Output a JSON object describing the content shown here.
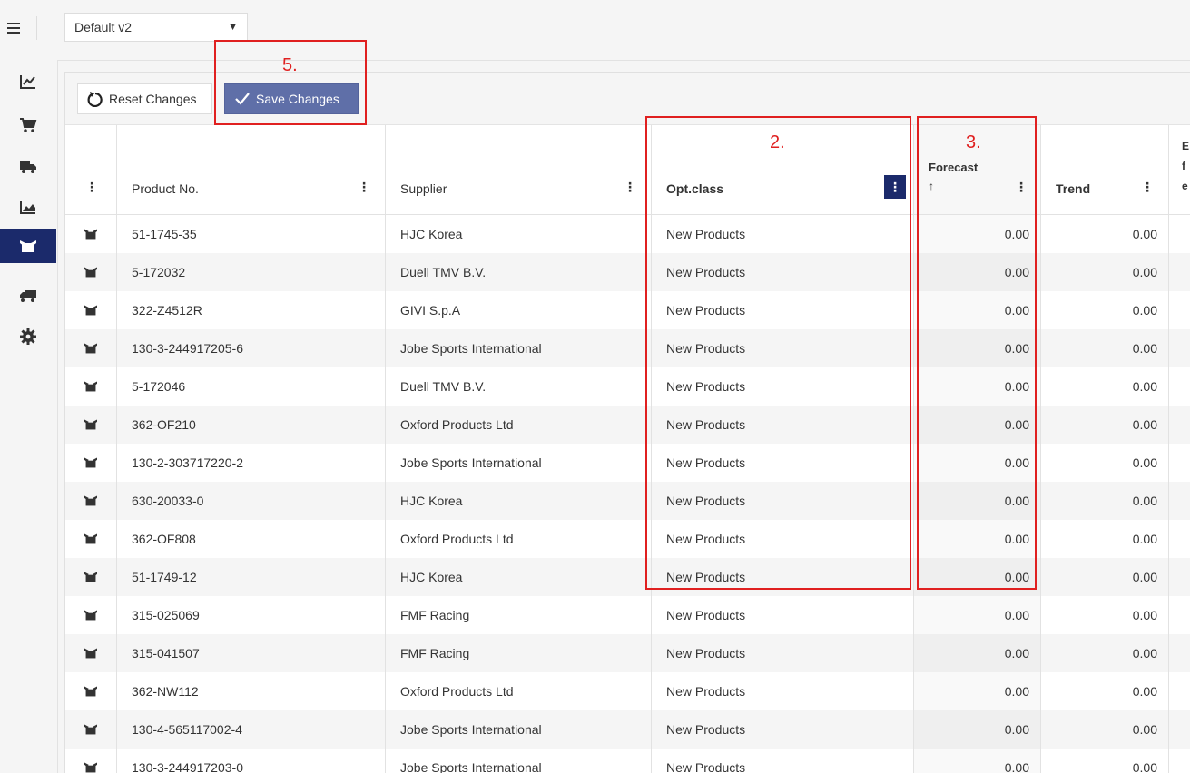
{
  "topbar": {
    "menu_icon": "hamburger-icon",
    "layout_select": {
      "value": "Default v2"
    }
  },
  "sidebar": {
    "items": [
      {
        "name": "line-chart-icon",
        "active": false
      },
      {
        "name": "cart-icon",
        "active": false
      },
      {
        "name": "delivery-truck-icon",
        "active": false
      },
      {
        "name": "area-chart-icon",
        "active": false
      },
      {
        "name": "open-box-icon",
        "active": true
      },
      {
        "name": "truck-icon",
        "active": false
      },
      {
        "name": "gear-icon",
        "active": false
      }
    ]
  },
  "toolbar": {
    "reset_label": "Reset Changes",
    "save_label": "Save Changes"
  },
  "grid": {
    "columns": [
      {
        "key": "menu",
        "label": ""
      },
      {
        "key": "product_no",
        "label": "Product No."
      },
      {
        "key": "supplier",
        "label": "Supplier"
      },
      {
        "key": "opt_class",
        "label": "Opt.class"
      },
      {
        "key": "forecast",
        "label": "Forecast",
        "sort_indicator": "↑"
      },
      {
        "key": "trend",
        "label": "Trend"
      },
      {
        "key": "next",
        "label": "E f e"
      }
    ],
    "rows": [
      {
        "product_no": "51-1745-35",
        "supplier": "HJC Korea",
        "opt_class": "New Products",
        "forecast": "0.00",
        "trend": "0.00"
      },
      {
        "product_no": "5-172032",
        "supplier": "Duell TMV B.V.",
        "opt_class": "New Products",
        "forecast": "0.00",
        "trend": "0.00"
      },
      {
        "product_no": "322-Z4512R",
        "supplier": "GIVI S.p.A",
        "opt_class": "New Products",
        "forecast": "0.00",
        "trend": "0.00"
      },
      {
        "product_no": "130-3-244917205-6",
        "supplier": "Jobe Sports International",
        "opt_class": "New Products",
        "forecast": "0.00",
        "trend": "0.00"
      },
      {
        "product_no": "5-172046",
        "supplier": "Duell TMV B.V.",
        "opt_class": "New Products",
        "forecast": "0.00",
        "trend": "0.00"
      },
      {
        "product_no": "362-OF210",
        "supplier": "Oxford Products Ltd",
        "opt_class": "New Products",
        "forecast": "0.00",
        "trend": "0.00"
      },
      {
        "product_no": "130-2-303717220-2",
        "supplier": "Jobe Sports International",
        "opt_class": "New Products",
        "forecast": "0.00",
        "trend": "0.00"
      },
      {
        "product_no": "630-20033-0",
        "supplier": "HJC Korea",
        "opt_class": "New Products",
        "forecast": "0.00",
        "trend": "0.00"
      },
      {
        "product_no": "362-OF808",
        "supplier": "Oxford Products Ltd",
        "opt_class": "New Products",
        "forecast": "0.00",
        "trend": "0.00"
      },
      {
        "product_no": "51-1749-12",
        "supplier": "HJC Korea",
        "opt_class": "New Products",
        "forecast": "0.00",
        "trend": "0.00"
      },
      {
        "product_no": "315-025069",
        "supplier": "FMF Racing",
        "opt_class": "New Products",
        "forecast": "0.00",
        "trend": "0.00"
      },
      {
        "product_no": "315-041507",
        "supplier": "FMF Racing",
        "opt_class": "New Products",
        "forecast": "0.00",
        "trend": "0.00"
      },
      {
        "product_no": "362-NW112",
        "supplier": "Oxford Products Ltd",
        "opt_class": "New Products",
        "forecast": "0.00",
        "trend": "0.00"
      },
      {
        "product_no": "130-4-565117002-4",
        "supplier": "Jobe Sports International",
        "opt_class": "New Products",
        "forecast": "0.00",
        "trend": "0.00"
      },
      {
        "product_no": "130-3-244917203-0",
        "supplier": "Jobe Sports International",
        "opt_class": "New Products",
        "forecast": "0.00",
        "trend": "0.00"
      }
    ]
  },
  "annotations": [
    {
      "label": "5."
    },
    {
      "label": "2."
    },
    {
      "label": "3."
    }
  ],
  "colors": {
    "accent_navy": "#1b2a6b",
    "save_button": "#5f6fa8",
    "annotation_red": "#e02020"
  }
}
